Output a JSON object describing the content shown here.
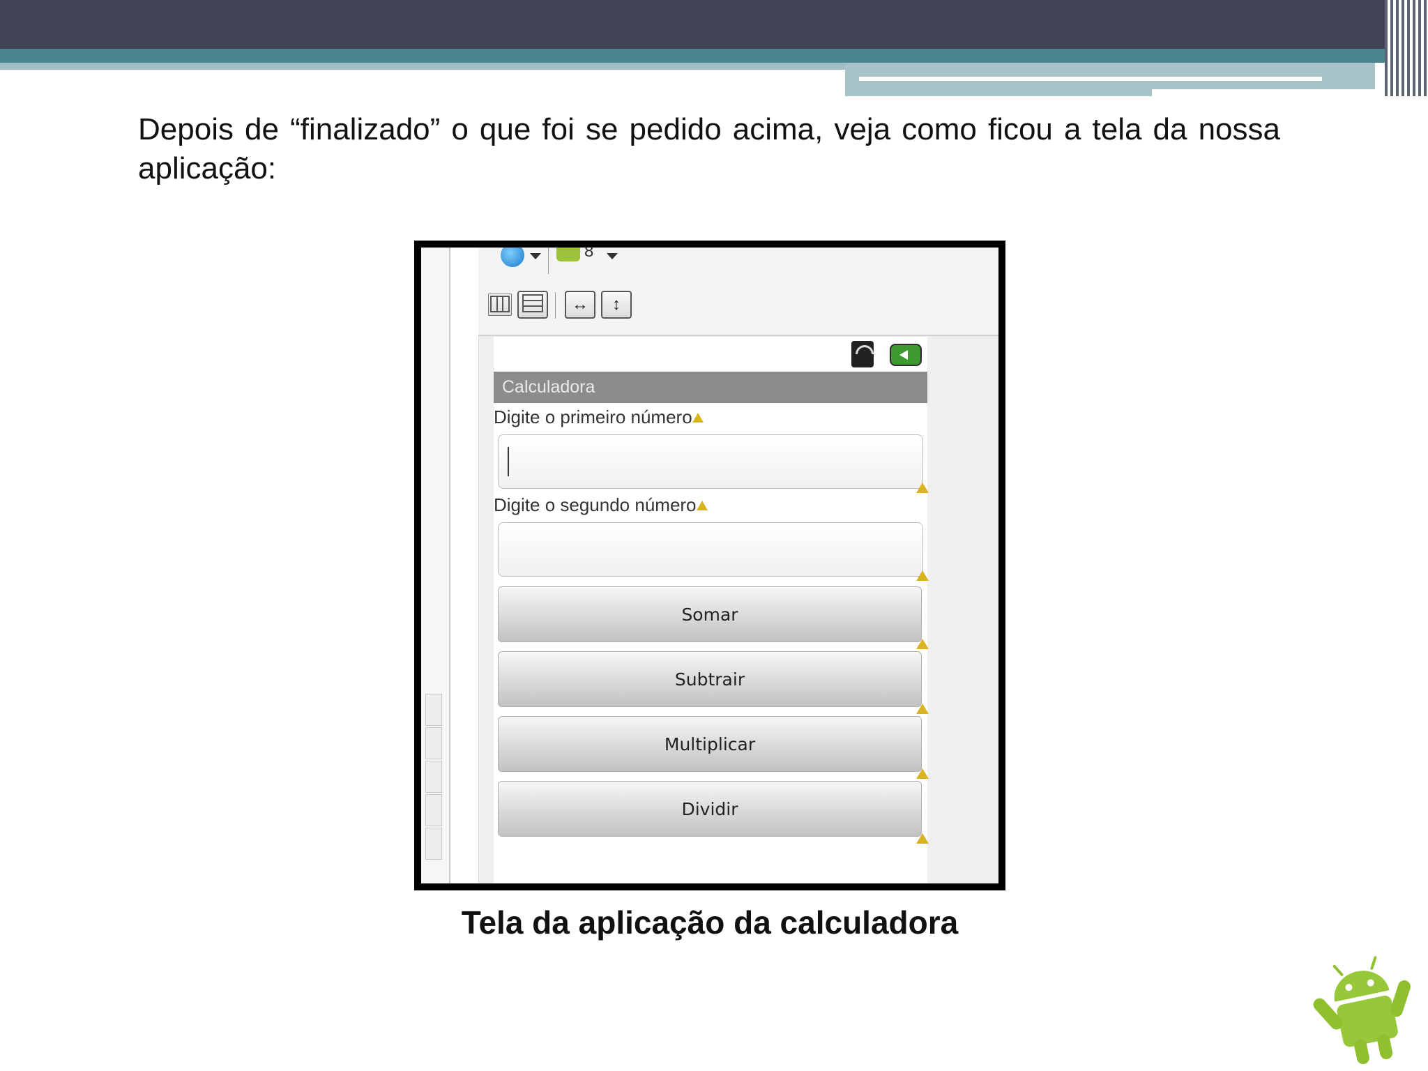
{
  "intro_text": "Depois de “finalizado” o que foi se pedido acima, veja como ficou a tela da nossa aplicação:",
  "caption": "Tela da aplicação da calculadora",
  "editor": {
    "api_level": "8"
  },
  "app": {
    "title": "Calculadora",
    "first_label": "Digite o primeiro número",
    "second_label": "Digite o segundo número",
    "first_value": "",
    "second_value": "",
    "buttons": [
      "Somar",
      "Subtrair",
      "Multiplicar",
      "Dividir"
    ]
  },
  "colors": {
    "header_dark": "#3f4353",
    "header_teal": "#4a8590",
    "title_bar": "#8c8c8c",
    "android_green": "#9dc33a",
    "warning": "#d8b423"
  }
}
